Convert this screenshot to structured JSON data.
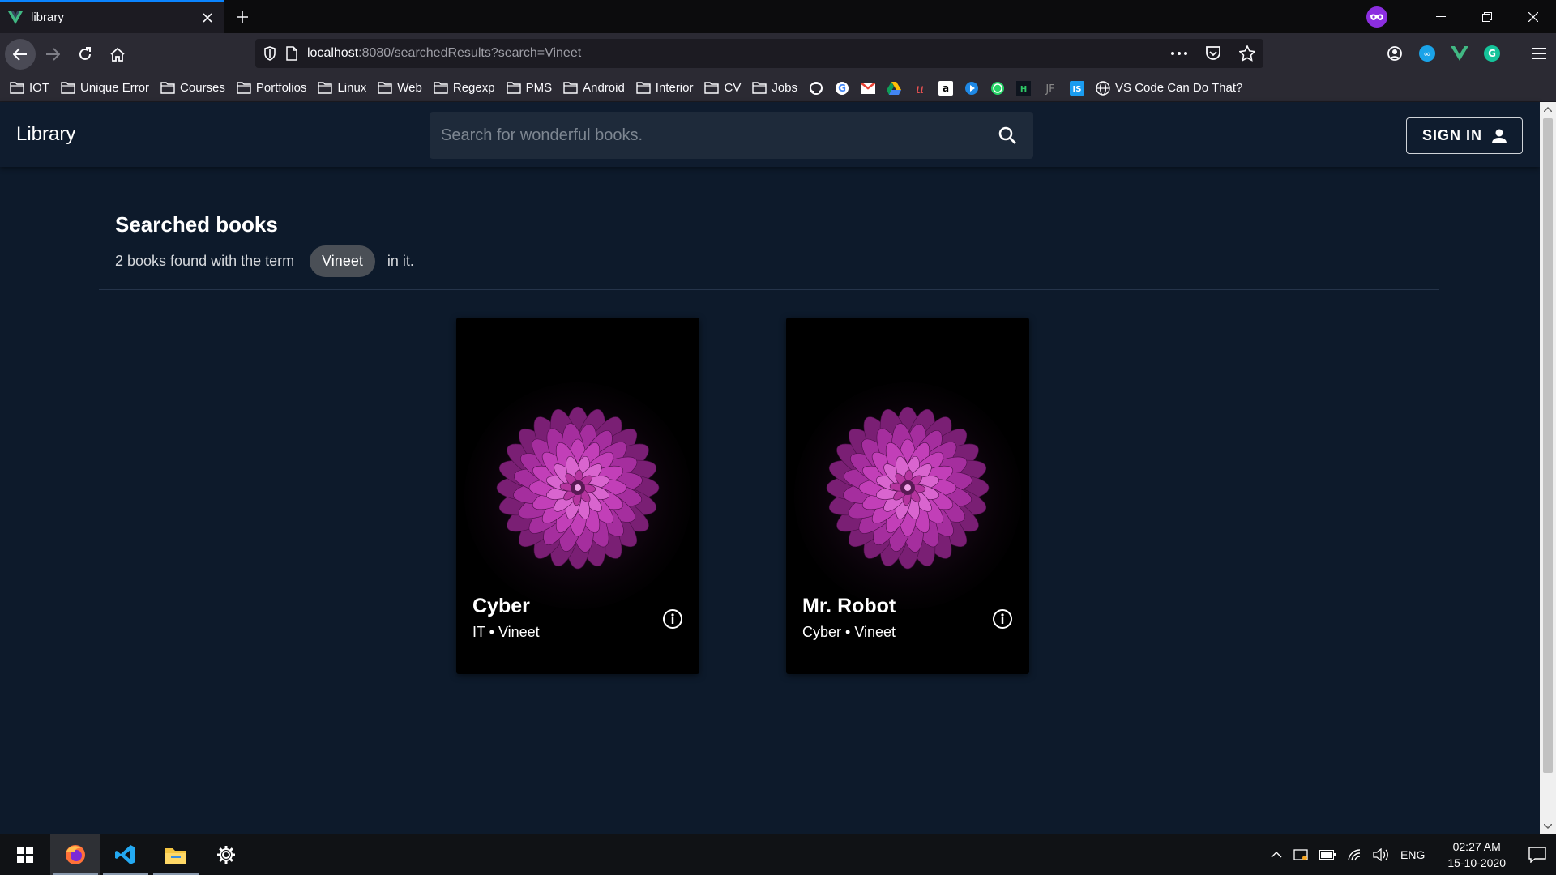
{
  "browser": {
    "tab_title": "library",
    "url_host": "localhost",
    "url_rest": ":8080/searchedResults?search=Vineet",
    "bookmarks": [
      "IOT",
      "Unique Error",
      "Courses",
      "Portfolios",
      "Linux",
      "Web",
      "Regexp",
      "PMS",
      "Android",
      "Interior",
      "CV",
      "Jobs"
    ],
    "bookmark_last": "VS Code Can Do That?"
  },
  "app": {
    "brand": "Library",
    "search_placeholder": "Search for wonderful books.",
    "signin_label": "SIGN IN"
  },
  "results": {
    "title": "Searched books",
    "prefix": "2 books found with the term",
    "term": "Vineet",
    "suffix": "in it.",
    "books": [
      {
        "title": "Cyber",
        "subtitle": "IT • Vineet"
      },
      {
        "title": "Mr. Robot",
        "subtitle": "Cyber • Vineet"
      }
    ]
  },
  "taskbar": {
    "language": "ENG",
    "time": "02:27 AM",
    "date": "15-10-2020"
  },
  "colors": {
    "page_bg": "#0d1a2b",
    "appbar_bg": "#0f1c2e",
    "card_bg": "#000000",
    "flower": "#c23fb8"
  }
}
